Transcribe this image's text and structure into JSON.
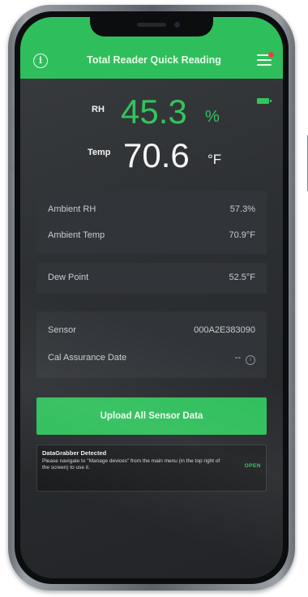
{
  "app": {
    "title": "Total Reader Quick Reading"
  },
  "reading": {
    "rh_label": "RH",
    "rh_value": "45.3",
    "rh_unit": "%",
    "temp_label": "Temp",
    "temp_value": "70.6",
    "temp_unit": "°F"
  },
  "ambient": [
    {
      "label": "Ambient RH",
      "value": "57.3%"
    },
    {
      "label": "Ambient Temp",
      "value": "70.9°F"
    }
  ],
  "dew_point": {
    "label": "Dew Point",
    "value": "52.5°F"
  },
  "sensor": [
    {
      "label": "Sensor",
      "value": "000A2E383090"
    },
    {
      "label": "Cal Assurance Date",
      "value": "--"
    }
  ],
  "upload_button": "Upload All Sensor Data",
  "banner": {
    "title": "DataGrabber Detected",
    "text": "Please navigate to \"Manage devices\" from the main menu (in the top right of the screen) to use it.",
    "action": "OPEN"
  },
  "icons": [
    "info-icon",
    "menu-icon",
    "battery-icon",
    "info-circle-icon"
  ],
  "colors": {
    "accent": "#2fbe5c",
    "value_green": "#34c45e",
    "background": "#2c2f32",
    "card": "#313438",
    "notification_dot": "#e8433b"
  }
}
